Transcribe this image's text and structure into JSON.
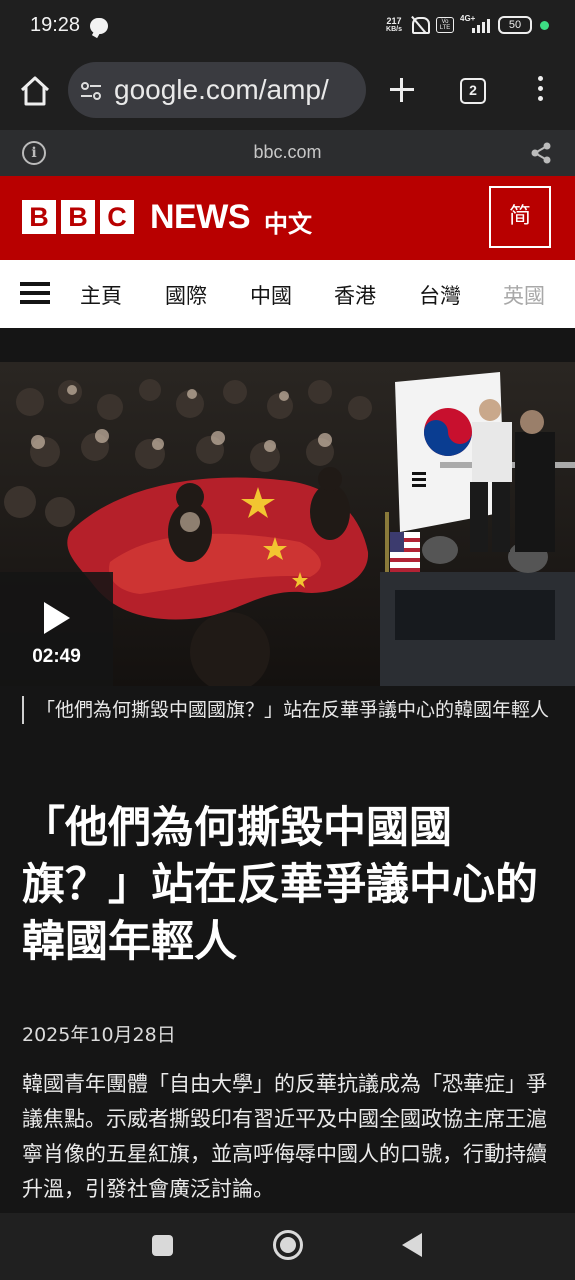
{
  "status_bar": {
    "time": "19:28",
    "net_speed_value": "217",
    "net_speed_unit": "KB/s",
    "network": "4G+",
    "volte": "Vo LTE",
    "battery": "50",
    "icons": [
      "line-app-icon",
      "bell-off-icon",
      "volte-icon",
      "signal-icon",
      "battery-icon",
      "charging-dot-icon"
    ]
  },
  "browser": {
    "url": "google.com/amp/",
    "tab_count": "2",
    "amp_domain": "bbc.com",
    "icons": [
      "home-icon",
      "tune-icon",
      "plus-icon",
      "tabs-icon",
      "more-vert-icon",
      "info-icon",
      "share-icon"
    ]
  },
  "header": {
    "logo_letters": [
      "B",
      "B",
      "C"
    ],
    "news": "NEWS",
    "chinese": "中文",
    "simplified_toggle": "简",
    "brand_color": "#b80000"
  },
  "nav": {
    "items": [
      "主頁",
      "國際",
      "中國",
      "香港",
      "台灣",
      "英國"
    ]
  },
  "video": {
    "duration": "02:49",
    "caption": "「他們為何撕毀中國國旗？」站在反華爭議中心的韓國年輕人"
  },
  "article": {
    "headline": "「他們為何撕毀中國國旗？」站在反華爭議中心的韓國年輕人",
    "date": "2025年10月28日",
    "summary": "韓國青年團體「自由大學」的反華抗議成為「恐華症」爭議焦點。示威者撕毀印有習近平及中國全國政協主席王滬寧肖像的五星紅旗，並高呼侮辱中國人的口號，行動持續升溫，引發社會廣泛討論。"
  },
  "system_nav": {
    "icons": [
      "recents-icon",
      "home-circle-icon",
      "back-icon"
    ]
  }
}
